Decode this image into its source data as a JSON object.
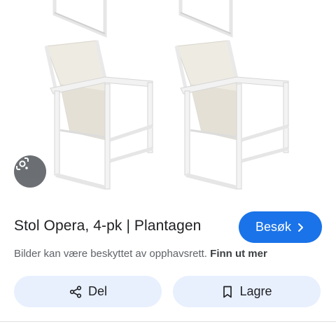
{
  "result": {
    "title": "Stol Opera, 4-pk | Plantagen",
    "visit_label": "Besøk",
    "copyright_text": "Bilder kan være beskyttet av opphavsrett.",
    "learn_more": "Finn ut mer"
  },
  "actions": {
    "share_label": "Del",
    "save_label": "Lagre"
  },
  "colors": {
    "accent": "#1a73e8",
    "action_bg": "#e8f0fe",
    "lens_bg": "#5f6368"
  },
  "icons": {
    "lens": "google-lens-icon",
    "share": "share-icon",
    "save": "bookmark-icon",
    "chevron": "chevron-right-icon"
  }
}
